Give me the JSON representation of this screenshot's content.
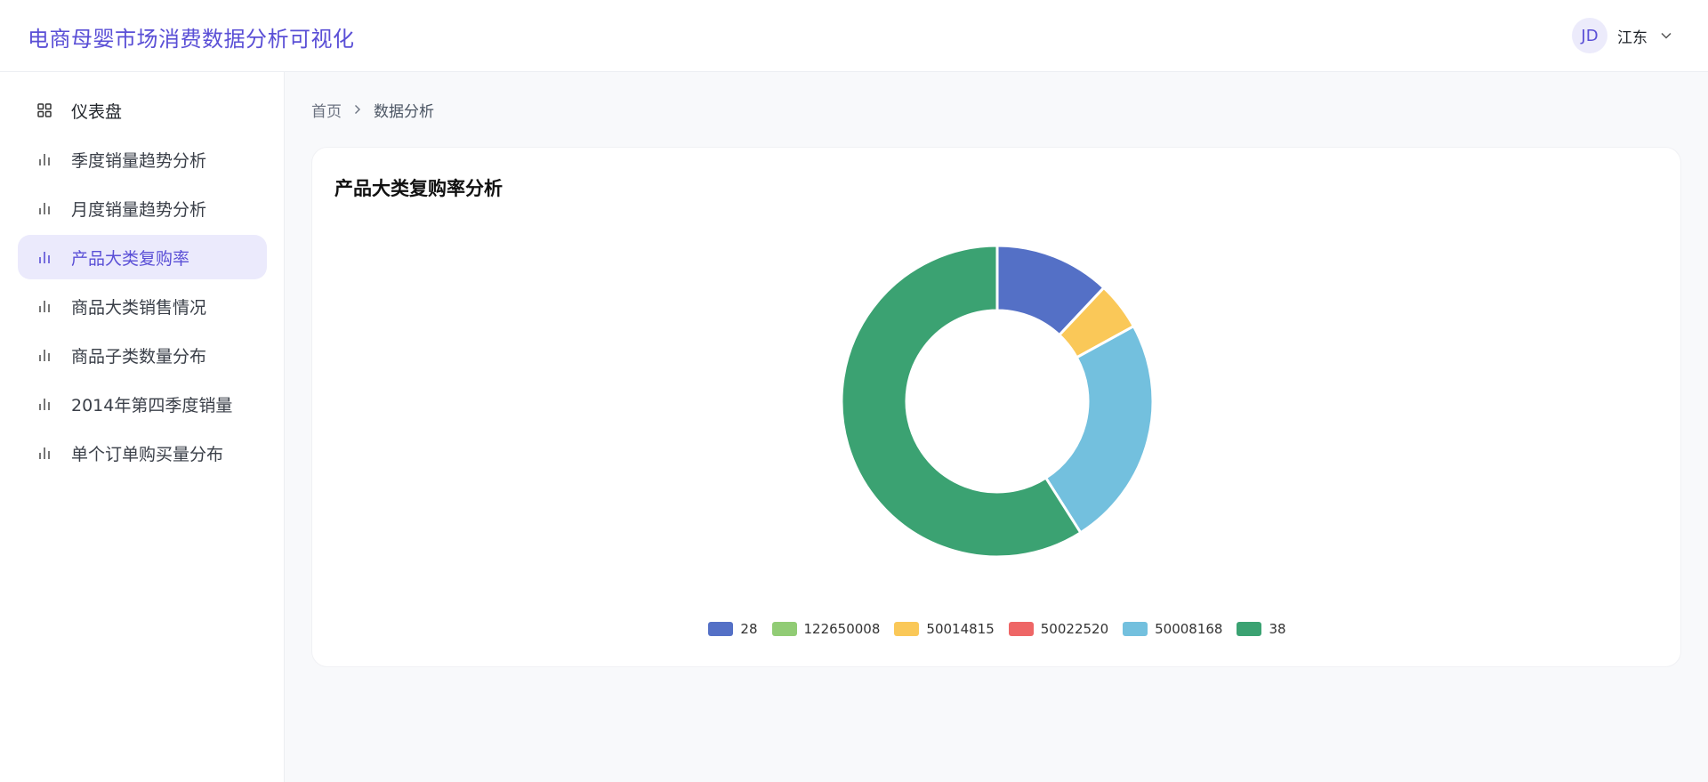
{
  "app": {
    "title": "电商母婴市场消费数据分析可视化"
  },
  "user": {
    "initials": "JD",
    "name": "江东",
    "menu_icon": "chevron-down-icon"
  },
  "sidebar": {
    "items": [
      {
        "label": "仪表盘",
        "icon": "grid-icon",
        "active": false
      },
      {
        "label": "季度销量趋势分析",
        "icon": "bar-chart-icon",
        "active": false
      },
      {
        "label": "月度销量趋势分析",
        "icon": "bar-chart-icon",
        "active": false
      },
      {
        "label": "产品大类复购率",
        "icon": "bar-chart-icon",
        "active": true
      },
      {
        "label": "商品大类销售情况",
        "icon": "bar-chart-icon",
        "active": false
      },
      {
        "label": "商品子类数量分布",
        "icon": "bar-chart-icon",
        "active": false
      },
      {
        "label": "2014年第四季度销量",
        "icon": "bar-chart-icon",
        "active": false
      },
      {
        "label": "单个订单购买量分布",
        "icon": "bar-chart-icon",
        "active": false
      }
    ]
  },
  "breadcrumb": {
    "home": "首页",
    "current": "数据分析",
    "separator_icon": "chevron-right-icon"
  },
  "colors": {
    "accent": "#5a4fd6",
    "active_bg": "#ebeafc"
  },
  "card": {
    "title": "产品大类复购率分析"
  },
  "chart_data": {
    "type": "pie",
    "donut": true,
    "title": "产品大类复购率分析",
    "legend_position": "bottom",
    "slices": [
      {
        "name": "28",
        "value": 12,
        "color": "#5470c6"
      },
      {
        "name": "122650008",
        "value": 0,
        "color": "#91cc75"
      },
      {
        "name": "50014815",
        "value": 5,
        "color": "#fac858"
      },
      {
        "name": "50022520",
        "value": 0,
        "color": "#ee6666"
      },
      {
        "name": "50008168",
        "value": 24,
        "color": "#73c0de"
      },
      {
        "name": "38",
        "value": 59,
        "color": "#3ba272"
      }
    ]
  }
}
